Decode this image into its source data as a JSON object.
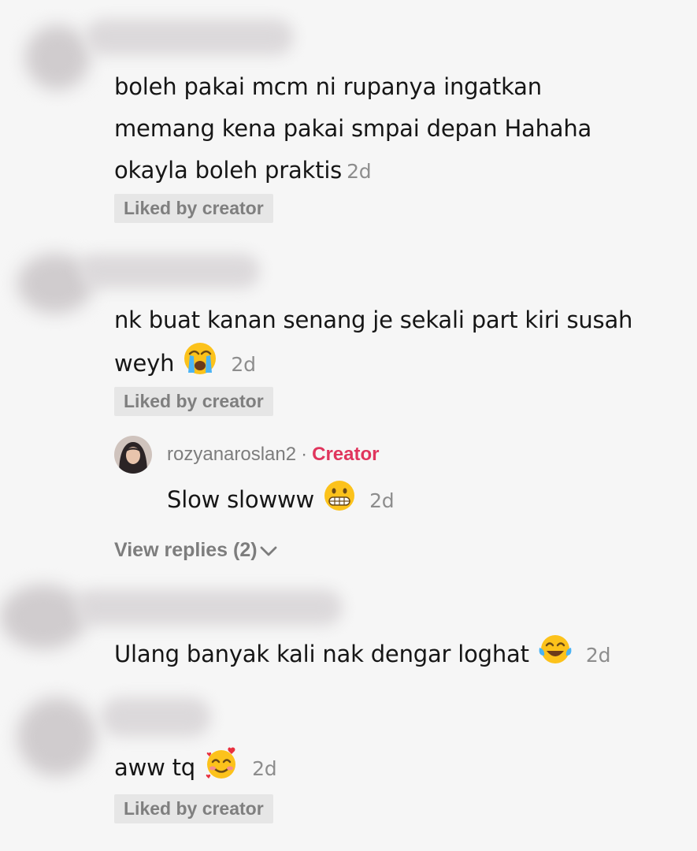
{
  "comments": [
    {
      "lines": [
        "boleh pakai mcm ni rupanya ingatkan",
        "memang kena pakai smpai depan Hahaha",
        "okayla boleh praktis"
      ],
      "time": "2d",
      "badge": "Liked by creator"
    },
    {
      "lines": [
        "nk buat kanan senang je sekali part kiri susah",
        "weyh"
      ],
      "emoji": "loudly-crying-face",
      "time": "2d",
      "badge": "Liked by creator",
      "reply": {
        "username": "rozyanaroslan2",
        "separator": "·",
        "role": "Creator",
        "text": "Slow slowww",
        "emoji": "grimacing-face",
        "time": "2d"
      },
      "view_replies": "View replies (2)"
    },
    {
      "lines": [
        "Ulang banyak kali nak dengar loghat"
      ],
      "emoji": "face-with-tears-of-joy",
      "time": "2d"
    },
    {
      "lines": [
        "aww tq"
      ],
      "emoji": "smiling-face-with-hearts",
      "time": "2d",
      "badge": "Liked by creator"
    }
  ],
  "colors": {
    "background": "#f6f6f6",
    "text": "#161616",
    "muted": "#8d8d8d",
    "badge_bg": "#e6e6e6",
    "creator_accent": "#e0355d"
  }
}
